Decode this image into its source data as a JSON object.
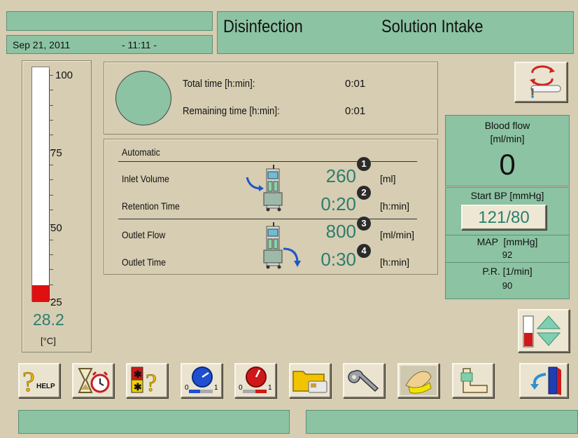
{
  "header": {
    "date": "Sep 21, 2011",
    "time": "- 11:11 -",
    "mode": "Disinfection",
    "phase": "Solution Intake"
  },
  "thermometer": {
    "scale_labels": [
      "100",
      "75",
      "50",
      "25"
    ],
    "value": "28.2",
    "unit": "[°C]",
    "scale_min": 25,
    "scale_max": 100,
    "reading": 28.2,
    "fill_color": "#e01010"
  },
  "timer": {
    "total_label": "Total time [h:min]:",
    "total_value": "0:01",
    "remaining_label": "Remaining time [h:min]:",
    "remaining_value": "0:01"
  },
  "program": {
    "mode_label": "Automatic",
    "rows": [
      {
        "label": "Inlet Volume",
        "value": "260",
        "badge": "1",
        "unit": "[ml]"
      },
      {
        "label": "Retention Time",
        "value": "0:20",
        "badge": "2",
        "unit": "[h:min]"
      },
      {
        "label": "Outlet Flow",
        "value": "800",
        "badge": "3",
        "unit": "[ml/min]"
      },
      {
        "label": "Outlet Time",
        "value": "0:30",
        "badge": "4",
        "unit": "[h:min]"
      }
    ]
  },
  "blood": {
    "flow_label": "Blood flow",
    "flow_unit": "[ml/min]",
    "flow_value": "0",
    "start_bp_label": "Start BP [mmHg]",
    "start_bp_value": "121/80",
    "map_label": "MAP  [mmHg]",
    "map_value": "92",
    "pr_label": "P.R. [1/min]",
    "pr_value": "90"
  },
  "toolbar": {
    "help_label": "HELP",
    "dial_min": "0",
    "dial_max": "1"
  },
  "colors": {
    "accent_green": "#8cc3a3",
    "value_teal": "#2d7d6e",
    "background": "#d6cdb2",
    "alarm_red": "#e01010"
  }
}
